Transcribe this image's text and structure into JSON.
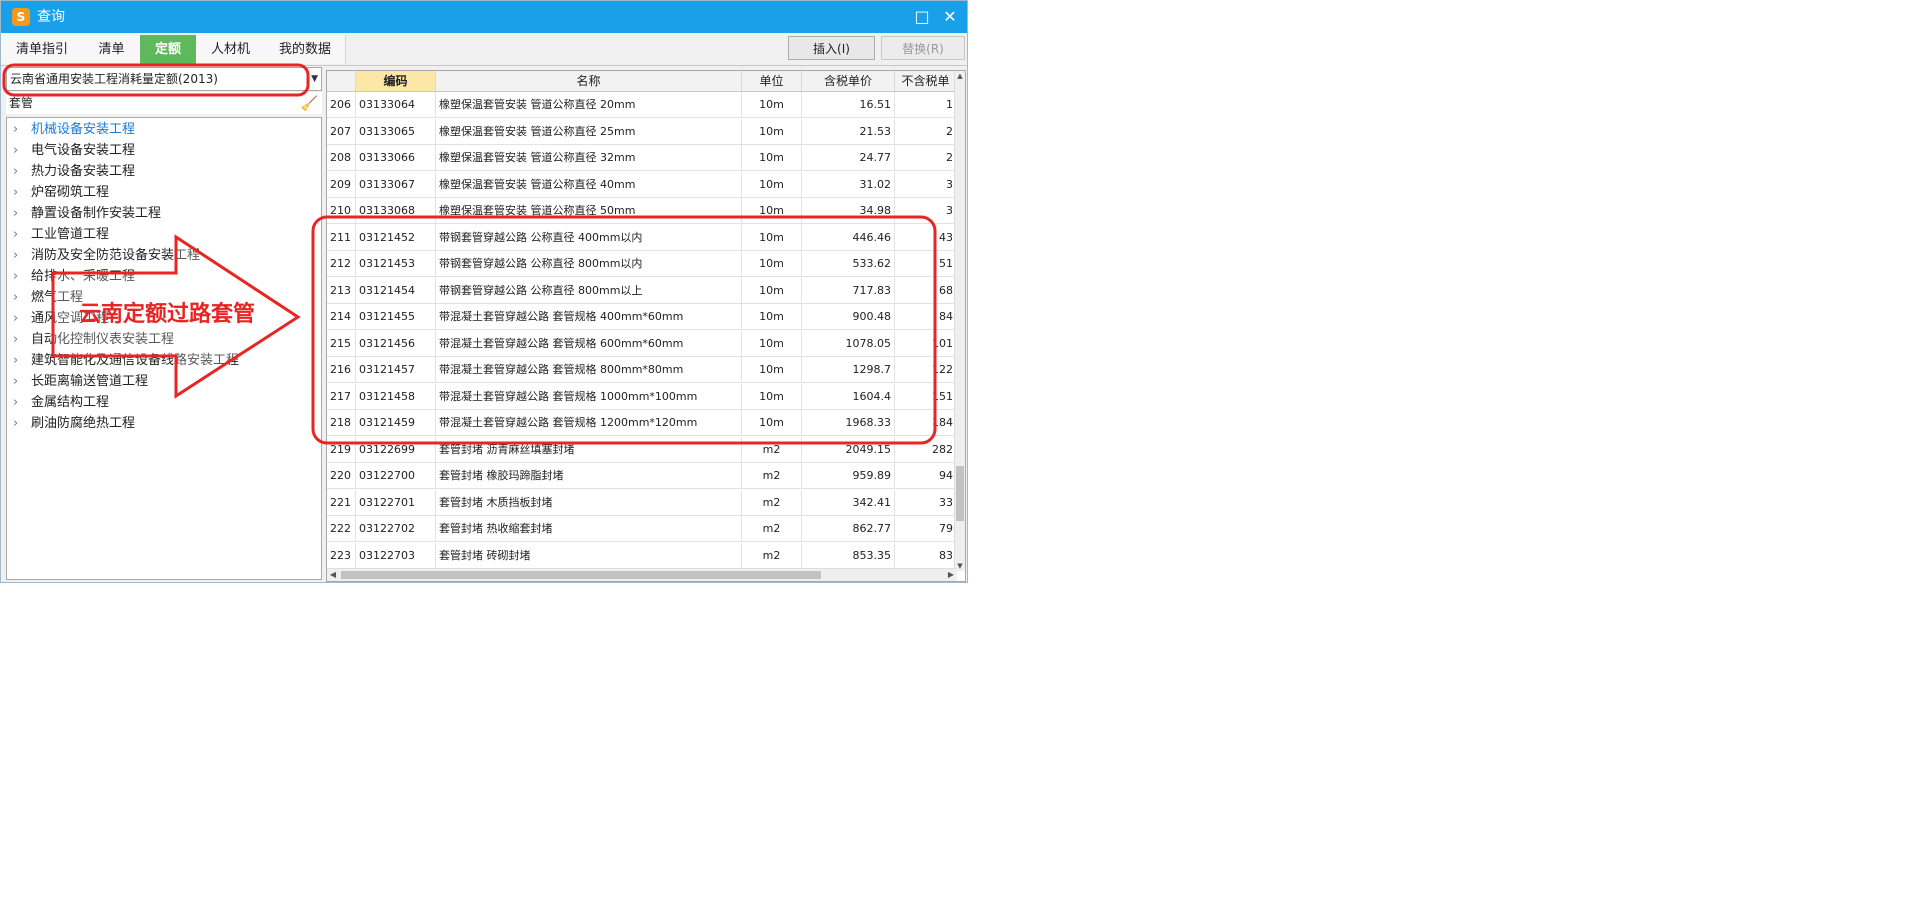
{
  "window": {
    "title": "查询",
    "maximize_glyph": "□",
    "close_glyph": "✕",
    "logo_glyph": "S"
  },
  "tabs": [
    {
      "label": "清单指引"
    },
    {
      "label": "清单"
    },
    {
      "label": "定额",
      "active": true
    },
    {
      "label": "人材机"
    },
    {
      "label": "我的数据"
    }
  ],
  "buttons": {
    "insert_label": "插入(I)",
    "replace_label": "替换(R)"
  },
  "left": {
    "library": "云南省通用安装工程消耗量定额(2013)",
    "search_value": "套管",
    "tree": [
      {
        "label": "机械设备安装工程",
        "selected": true
      },
      {
        "label": "电气设备安装工程"
      },
      {
        "label": "热力设备安装工程"
      },
      {
        "label": "炉窑砌筑工程"
      },
      {
        "label": "静置设备制作安装工程"
      },
      {
        "label": "工业管道工程"
      },
      {
        "label": "消防及安全防范设备安装工程"
      },
      {
        "label": "给排水、采暖工程"
      },
      {
        "label": "燃气工程"
      },
      {
        "label": "通风空调工程"
      },
      {
        "label": "自动化控制仪表安装工程"
      },
      {
        "label": "建筑智能化及通信设备线路安装工程"
      },
      {
        "label": "长距离输送管道工程"
      },
      {
        "label": "金属结构工程"
      },
      {
        "label": "刷油防腐绝热工程"
      }
    ]
  },
  "grid": {
    "columns": [
      "",
      "编码",
      "名称",
      "单位",
      "含税单价",
      "不含税单"
    ],
    "rows": [
      {
        "idx": "206",
        "code": "03133064",
        "name": "橡塑保温套管安装 管道公称直径 20mm",
        "unit": "10m",
        "tax": "16.51",
        "notax": "1"
      },
      {
        "idx": "207",
        "code": "03133065",
        "name": "橡塑保温套管安装 管道公称直径 25mm",
        "unit": "10m",
        "tax": "21.53",
        "notax": "2"
      },
      {
        "idx": "208",
        "code": "03133066",
        "name": "橡塑保温套管安装 管道公称直径 32mm",
        "unit": "10m",
        "tax": "24.77",
        "notax": "2"
      },
      {
        "idx": "209",
        "code": "03133067",
        "name": "橡塑保温套管安装 管道公称直径 40mm",
        "unit": "10m",
        "tax": "31.02",
        "notax": "3"
      },
      {
        "idx": "210",
        "code": "03133068",
        "name": "橡塑保温套管安装 管道公称直径 50mm",
        "unit": "10m",
        "tax": "34.98",
        "notax": "3"
      },
      {
        "idx": "211",
        "code": "03121452",
        "name": "带钢套管穿越公路 公称直径 400mm以内",
        "unit": "10m",
        "tax": "446.46",
        "notax": "43"
      },
      {
        "idx": "212",
        "code": "03121453",
        "name": "带钢套管穿越公路 公称直径 800mm以内",
        "unit": "10m",
        "tax": "533.62",
        "notax": "51"
      },
      {
        "idx": "213",
        "code": "03121454",
        "name": "带钢套管穿越公路 公称直径 800mm以上",
        "unit": "10m",
        "tax": "717.83",
        "notax": "68"
      },
      {
        "idx": "214",
        "code": "03121455",
        "name": "带混凝土套管穿越公路 套管规格 400mm*60mm",
        "unit": "10m",
        "tax": "900.48",
        "notax": "84"
      },
      {
        "idx": "215",
        "code": "03121456",
        "name": "带混凝土套管穿越公路 套管规格 600mm*60mm",
        "unit": "10m",
        "tax": "1078.05",
        "notax": "101"
      },
      {
        "idx": "216",
        "code": "03121457",
        "name": "带混凝土套管穿越公路 套管规格 800mm*80mm",
        "unit": "10m",
        "tax": "1298.7",
        "notax": "122"
      },
      {
        "idx": "217",
        "code": "03121458",
        "name": "带混凝土套管穿越公路 套管规格 1000mm*100mm",
        "unit": "10m",
        "tax": "1604.4",
        "notax": "151"
      },
      {
        "idx": "218",
        "code": "03121459",
        "name": "带混凝土套管穿越公路 套管规格 1200mm*120mm",
        "unit": "10m",
        "tax": "1968.33",
        "notax": "184"
      },
      {
        "idx": "219",
        "code": "03122699",
        "name": "套管封堵 沥青麻丝填塞封堵",
        "unit": "m2",
        "tax": "2049.15",
        "notax": "282"
      },
      {
        "idx": "220",
        "code": "03122700",
        "name": "套管封堵 橡胶玛蹄脂封堵",
        "unit": "m2",
        "tax": "959.89",
        "notax": "94"
      },
      {
        "idx": "221",
        "code": "03122701",
        "name": "套管封堵 木质挡板封堵",
        "unit": "m2",
        "tax": "342.41",
        "notax": "33"
      },
      {
        "idx": "222",
        "code": "03122702",
        "name": "套管封堵 热收缩套封堵",
        "unit": "m2",
        "tax": "862.77",
        "notax": "79"
      },
      {
        "idx": "223",
        "code": "03122703",
        "name": "套管封堵 砖砌封堵",
        "unit": "m2",
        "tax": "853.35",
        "notax": "83"
      }
    ]
  },
  "annotation": {
    "text": "云南定额过路套管",
    "color": "#e82525"
  },
  "colors": {
    "titlebar": "#1aa0e8",
    "active_tab": "#5fb85c",
    "active_header": "#fbe7a6",
    "selected_tree": "#1e7ad0"
  }
}
